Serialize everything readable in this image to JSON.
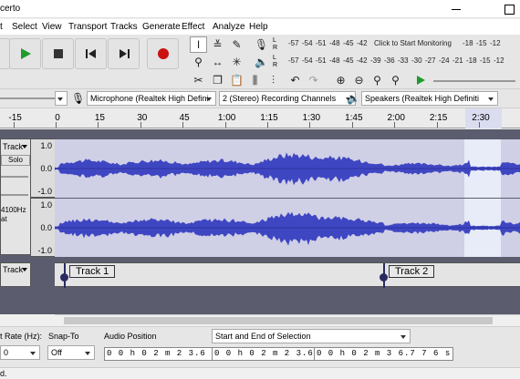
{
  "window": {
    "title": "certo"
  },
  "menu": [
    "t",
    "Select",
    "View",
    "Transport",
    "Tracks",
    "Generate",
    "Effect",
    "Analyze",
    "Help"
  ],
  "meters": {
    "record_ticks": [
      "-57",
      "-54",
      "-51",
      "-48",
      "-45",
      "-42"
    ],
    "record_right_ticks": [
      "-18",
      "-15",
      "-12"
    ],
    "record_hint": "Click to Start Monitoring",
    "play_ticks": [
      "-57",
      "-54",
      "-51",
      "-48",
      "-45",
      "-42",
      "-39",
      "-36",
      "-33",
      "-30",
      "-27",
      "-24",
      "-21",
      "-18",
      "-15",
      "-12"
    ],
    "channel_left": "L",
    "channel_right": "R"
  },
  "devices": {
    "input": "Microphone (Realtek High Defini",
    "channels": "2 (Stereo) Recording Channels",
    "output": "Speakers (Realtek High Definiti"
  },
  "ruler": [
    "-15",
    "0",
    "15",
    "30",
    "45",
    "1:00",
    "1:15",
    "1:30",
    "1:45",
    "2:00",
    "2:15",
    "2:30"
  ],
  "track": {
    "name": "Track",
    "solo": "Solo",
    "rate": "4100Hz",
    "format": "at",
    "scale_top": [
      "1.0",
      "0.0",
      "-1.0"
    ],
    "scale_bottom": [
      "1.0",
      "0.0",
      "-1.0"
    ]
  },
  "label_track": {
    "name": "Track",
    "labels": [
      "Track 1",
      "Track 2"
    ]
  },
  "selection_toolbar": {
    "rate_label": "t Rate (Hz):",
    "rate_value": "0",
    "snap_label": "Snap-To",
    "snap_value": "Off",
    "audio_position_label": "Audio Position",
    "audio_position": "0 0 h 0 2 m 2 3.6 5 3 s",
    "selection_mode": "Start and End of Selection",
    "sel_start": "0 0 h 0 2 m 2 3.6 5 3 s",
    "sel_end": "0 0 h 0 2 m 3 6.7 7 6 s"
  },
  "status": {
    "text": "d."
  },
  "colors": {
    "waveform": "#3f46c2",
    "track_bg": "#cfcfe6",
    "selection": "#e8ecf8",
    "label_pin": "#2a2a62",
    "record": "#cc1111",
    "play": "#1f9b2e"
  }
}
